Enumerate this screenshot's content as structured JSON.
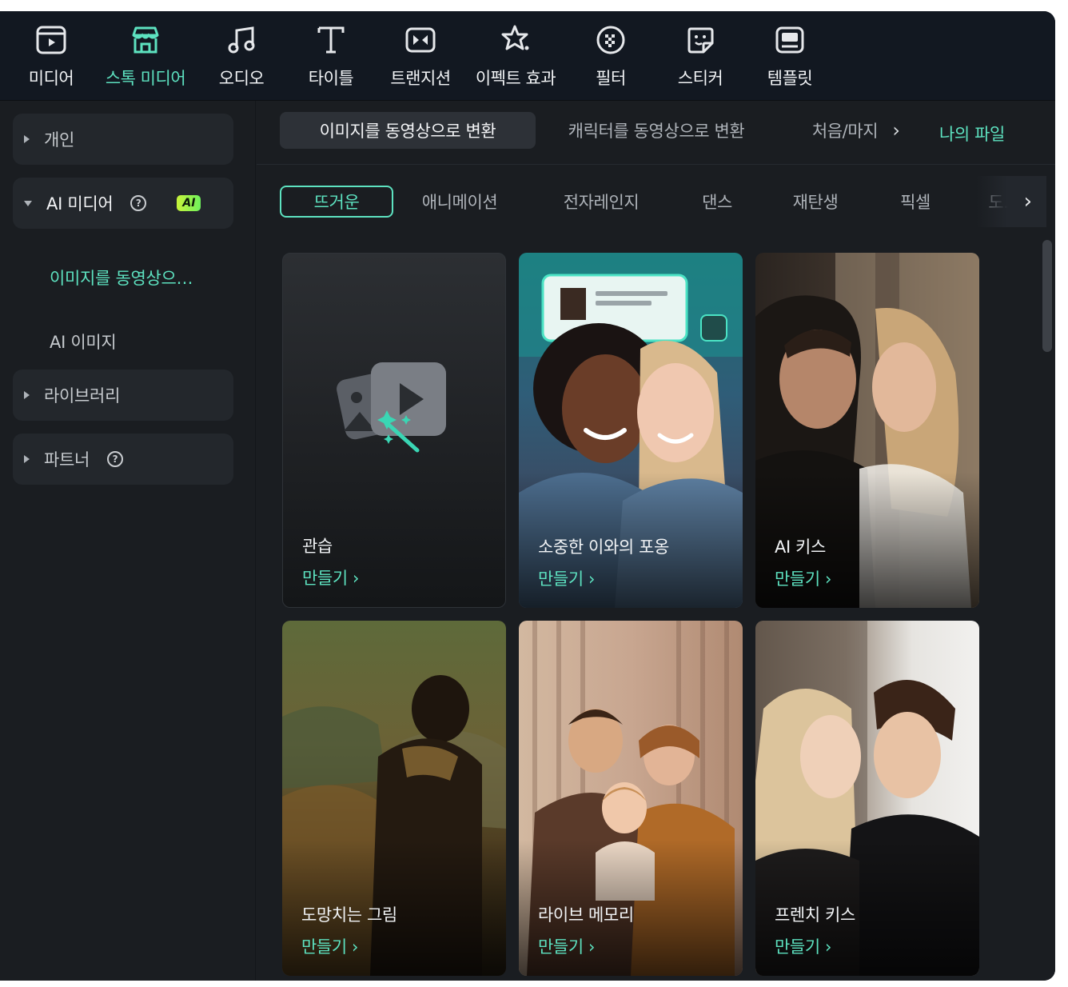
{
  "toolbar": {
    "items": [
      {
        "label": "미디어",
        "icon": "media-icon"
      },
      {
        "label": "스톡 미디어",
        "icon": "stock-store-icon"
      },
      {
        "label": "오디오",
        "icon": "music-note-icon"
      },
      {
        "label": "타이틀",
        "icon": "title-t-icon"
      },
      {
        "label": "트랜지션",
        "icon": "transition-icon"
      },
      {
        "label": "이펙트 효과",
        "icon": "effects-star-icon"
      },
      {
        "label": "필터",
        "icon": "filter-icon"
      },
      {
        "label": "스티커",
        "icon": "sticker-icon"
      },
      {
        "label": "템플릿",
        "icon": "template-icon"
      }
    ],
    "active_index": 1
  },
  "sidebar": {
    "personal": "개인",
    "ai_media": "AI 미디어",
    "ai_badge": "AI",
    "ai_sub_video": "이미지를 동영상으…",
    "ai_sub_image": "AI 이미지",
    "library": "라이브러리",
    "partner": "파트너"
  },
  "tabs": {
    "img_to_video": "이미지를 동영상으로 변환",
    "char_to_video": "캐릭터를 동영상으로 변환",
    "first_last": "처음/마지",
    "my_files": "나의 파일"
  },
  "categories": [
    "뜨거운",
    "애니메이션",
    "전자레인지",
    "댄스",
    "재탄생",
    "픽셀",
    "도."
  ],
  "make_label": "만들기 ›",
  "cards": [
    {
      "title": "관습"
    },
    {
      "title": "소중한 이와의 포옹"
    },
    {
      "title": "AI 키스"
    },
    {
      "title": "도망치는 그림"
    },
    {
      "title": "라이브 메모리"
    },
    {
      "title": "프렌치 키스"
    }
  ],
  "colors": {
    "accent": "#5de2c0",
    "bg": "#1a1d21",
    "toolbar_bg": "#121821"
  }
}
